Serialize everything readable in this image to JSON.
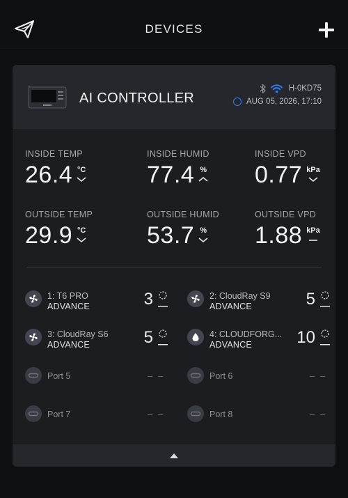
{
  "header": {
    "title": "DEVICES",
    "logo_icon": "paper-plane-logo-icon",
    "add_icon": "plus-icon"
  },
  "device": {
    "name": "AI CONTROLLER",
    "connection_id": "H-0KD75",
    "bluetooth_icon": "bluetooth-icon",
    "wifi_icon": "wifi-icon",
    "timestamp": "AUG 05, 2026, 17:10",
    "accent_color": "#2f7bf0"
  },
  "metrics": {
    "inside_temp": {
      "label": "INSIDE TEMP",
      "value": "26.4",
      "unit": "°C",
      "trend": "down"
    },
    "inside_humid": {
      "label": "INSIDE HUMID",
      "value": "77.4",
      "unit": "%",
      "trend": "up"
    },
    "inside_vpd": {
      "label": "INSIDE VPD",
      "value": "0.77",
      "unit": "kPa",
      "trend": "down"
    },
    "outside_temp": {
      "label": "OUTSIDE TEMP",
      "value": "29.9",
      "unit": "°C",
      "trend": "down"
    },
    "outside_humid": {
      "label": "OUTSIDE HUMID",
      "value": "53.7",
      "unit": "%",
      "trend": "down"
    },
    "outside_vpd": {
      "label": "OUTSIDE VPD",
      "value": "1.88",
      "unit": "kPa",
      "trend": "flat"
    }
  },
  "ports": [
    {
      "name": "1: T6 PRO",
      "mode": "ADVANCE",
      "level": "3",
      "icon": "fan-icon"
    },
    {
      "name": "2: CloudRay S9",
      "mode": "ADVANCE",
      "level": "5",
      "icon": "fan-icon"
    },
    {
      "name": "3: CloudRay S6",
      "mode": "ADVANCE",
      "level": "5",
      "icon": "fan-icon"
    },
    {
      "name": "4: CLOUDFORG...",
      "mode": "ADVANCE",
      "level": "10",
      "icon": "water-drop-icon"
    },
    {
      "name": "Port 5",
      "placeholder": "– –",
      "icon": "plug-icon"
    },
    {
      "name": "Port 6",
      "placeholder": "– –",
      "icon": "plug-icon"
    },
    {
      "name": "Port 7",
      "placeholder": "– –",
      "icon": "plug-icon"
    },
    {
      "name": "Port 8",
      "placeholder": "– –",
      "icon": "plug-icon"
    }
  ],
  "footer": {
    "collapse_icon": "caret-up-icon"
  }
}
